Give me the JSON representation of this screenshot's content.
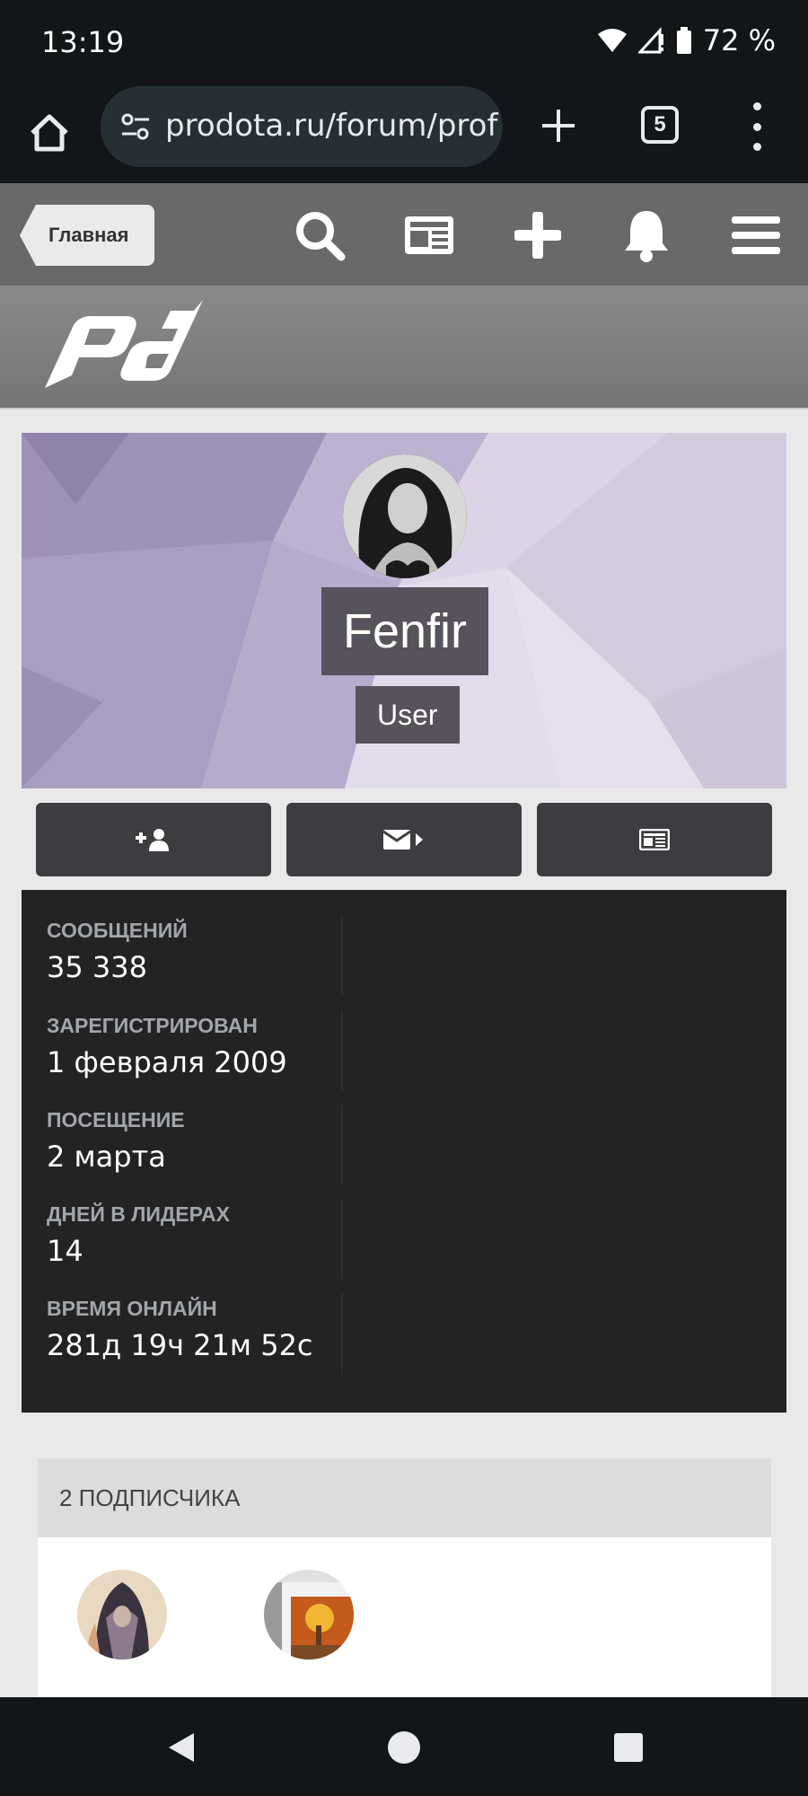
{
  "status_bar": {
    "time": "13:19",
    "battery": "72 %"
  },
  "browser": {
    "url": "prodota.ru/forum/prof",
    "tab_count": "5"
  },
  "site_nav": {
    "home_label": "Главная"
  },
  "profile": {
    "username": "Fenfir",
    "role": "User"
  },
  "stats": [
    {
      "label": "СООБЩЕНИЙ",
      "value": "35 338"
    },
    {
      "label": "ЗАРЕГИСТРИРОВАН",
      "value": "1 февраля 2009"
    },
    {
      "label": "ПОСЕЩЕНИЕ",
      "value": "2 марта"
    },
    {
      "label": "ДНЕЙ В ЛИДЕРАХ",
      "value": "14"
    },
    {
      "label": "ВРЕМЯ ОНЛАЙН",
      "value": "281д 19ч 21м 52с"
    }
  ],
  "followers": {
    "title": "2 ПОДПИСЧИКА"
  },
  "colors": {
    "accent_dark": "#3c3d40",
    "stats_bg": "#232324",
    "header_gray": "#696969"
  },
  "icons": [
    "home-icon",
    "site-settings-icon",
    "plus-icon",
    "tabs-icon",
    "more-icon",
    "search-icon",
    "news-icon",
    "add-icon",
    "bell-icon",
    "hamburger-icon",
    "add-friend-icon",
    "message-icon",
    "activity-icon"
  ]
}
